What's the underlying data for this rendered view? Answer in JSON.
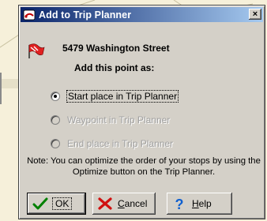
{
  "dialog": {
    "title": "Add to Trip Planner",
    "title_icon": "trip-planner-icon",
    "close_glyph": "×",
    "address_icon": "pushpin-flag-icon",
    "address": "5479 Washington Street",
    "prompt": "Add this point as:",
    "options": [
      {
        "label": "Start place in Trip Planner",
        "checked": true,
        "enabled": true
      },
      {
        "label": "Waypoint in Trip Planner",
        "checked": false,
        "enabled": false
      },
      {
        "label": "End place in Trip Planner",
        "checked": false,
        "enabled": false
      }
    ],
    "note": "Note: You can optimize the order of your stops by using the Optimize button on the Trip Planner.",
    "buttons": {
      "ok": {
        "label": "OK",
        "icon": "checkmark-icon"
      },
      "cancel": {
        "label_prefix": "",
        "label_accel": "C",
        "label_rest": "ancel",
        "icon": "red-x-icon"
      },
      "help": {
        "label_accel": "H",
        "label_rest": "elp",
        "icon": "question-mark-icon"
      }
    }
  },
  "colors": {
    "title_start": "#0a246a",
    "title_end": "#a6caf0",
    "dialog_face": "#d4d0c8",
    "disabled_text": "#a0a0a0"
  }
}
